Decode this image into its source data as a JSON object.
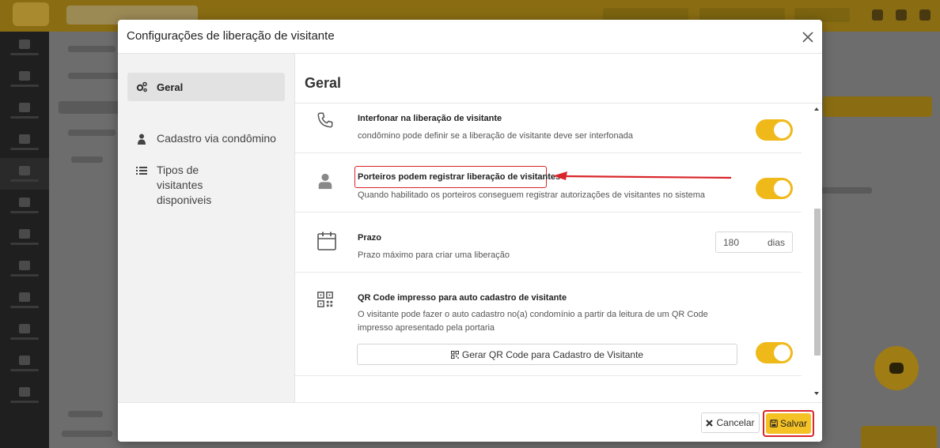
{
  "colors": {
    "accent": "#f0b91a",
    "save_button": "#f5c225",
    "annotation_red": "#d9252a"
  },
  "modal": {
    "title": "Configurações de liberação de visitante",
    "nav": [
      {
        "label": "Geral",
        "icon": "cogs-icon",
        "active": true
      },
      {
        "label": "Cadastro via condômino",
        "icon": "user-icon",
        "active": false
      },
      {
        "label": "Tipos de visitantes disponiveis",
        "icon": "list-icon",
        "active": false
      }
    ],
    "section_title": "Geral",
    "settings": [
      {
        "icon": "phone-icon",
        "title": "Interfonar na liberação de visitante",
        "description": "condômino pode definir se a liberação de visitante deve ser interfonada",
        "enabled": true
      },
      {
        "icon": "user-icon",
        "title": "Porteiros podem registrar liberação de visitantes",
        "description": "Quando habilitado os porteiros conseguem registrar autorizações de visitantes no sistema",
        "enabled": true
      },
      {
        "icon": "calendar-icon",
        "title": "Prazo",
        "description": "Prazo máximo para criar uma liberação",
        "value": "180",
        "unit": "dias"
      },
      {
        "icon": "qrcode-icon",
        "title": "QR Code impresso para auto cadastro de visitante",
        "description": "O visitante pode fazer o auto cadastro no(a) condomínio a partir da leitura de um QR Code impresso apresentado pela portaria",
        "button_label": "Gerar QR Code para Cadastro de Visitante",
        "enabled": true
      }
    ],
    "footer": {
      "cancel_label": "Cancelar",
      "save_label": "Salvar"
    }
  }
}
